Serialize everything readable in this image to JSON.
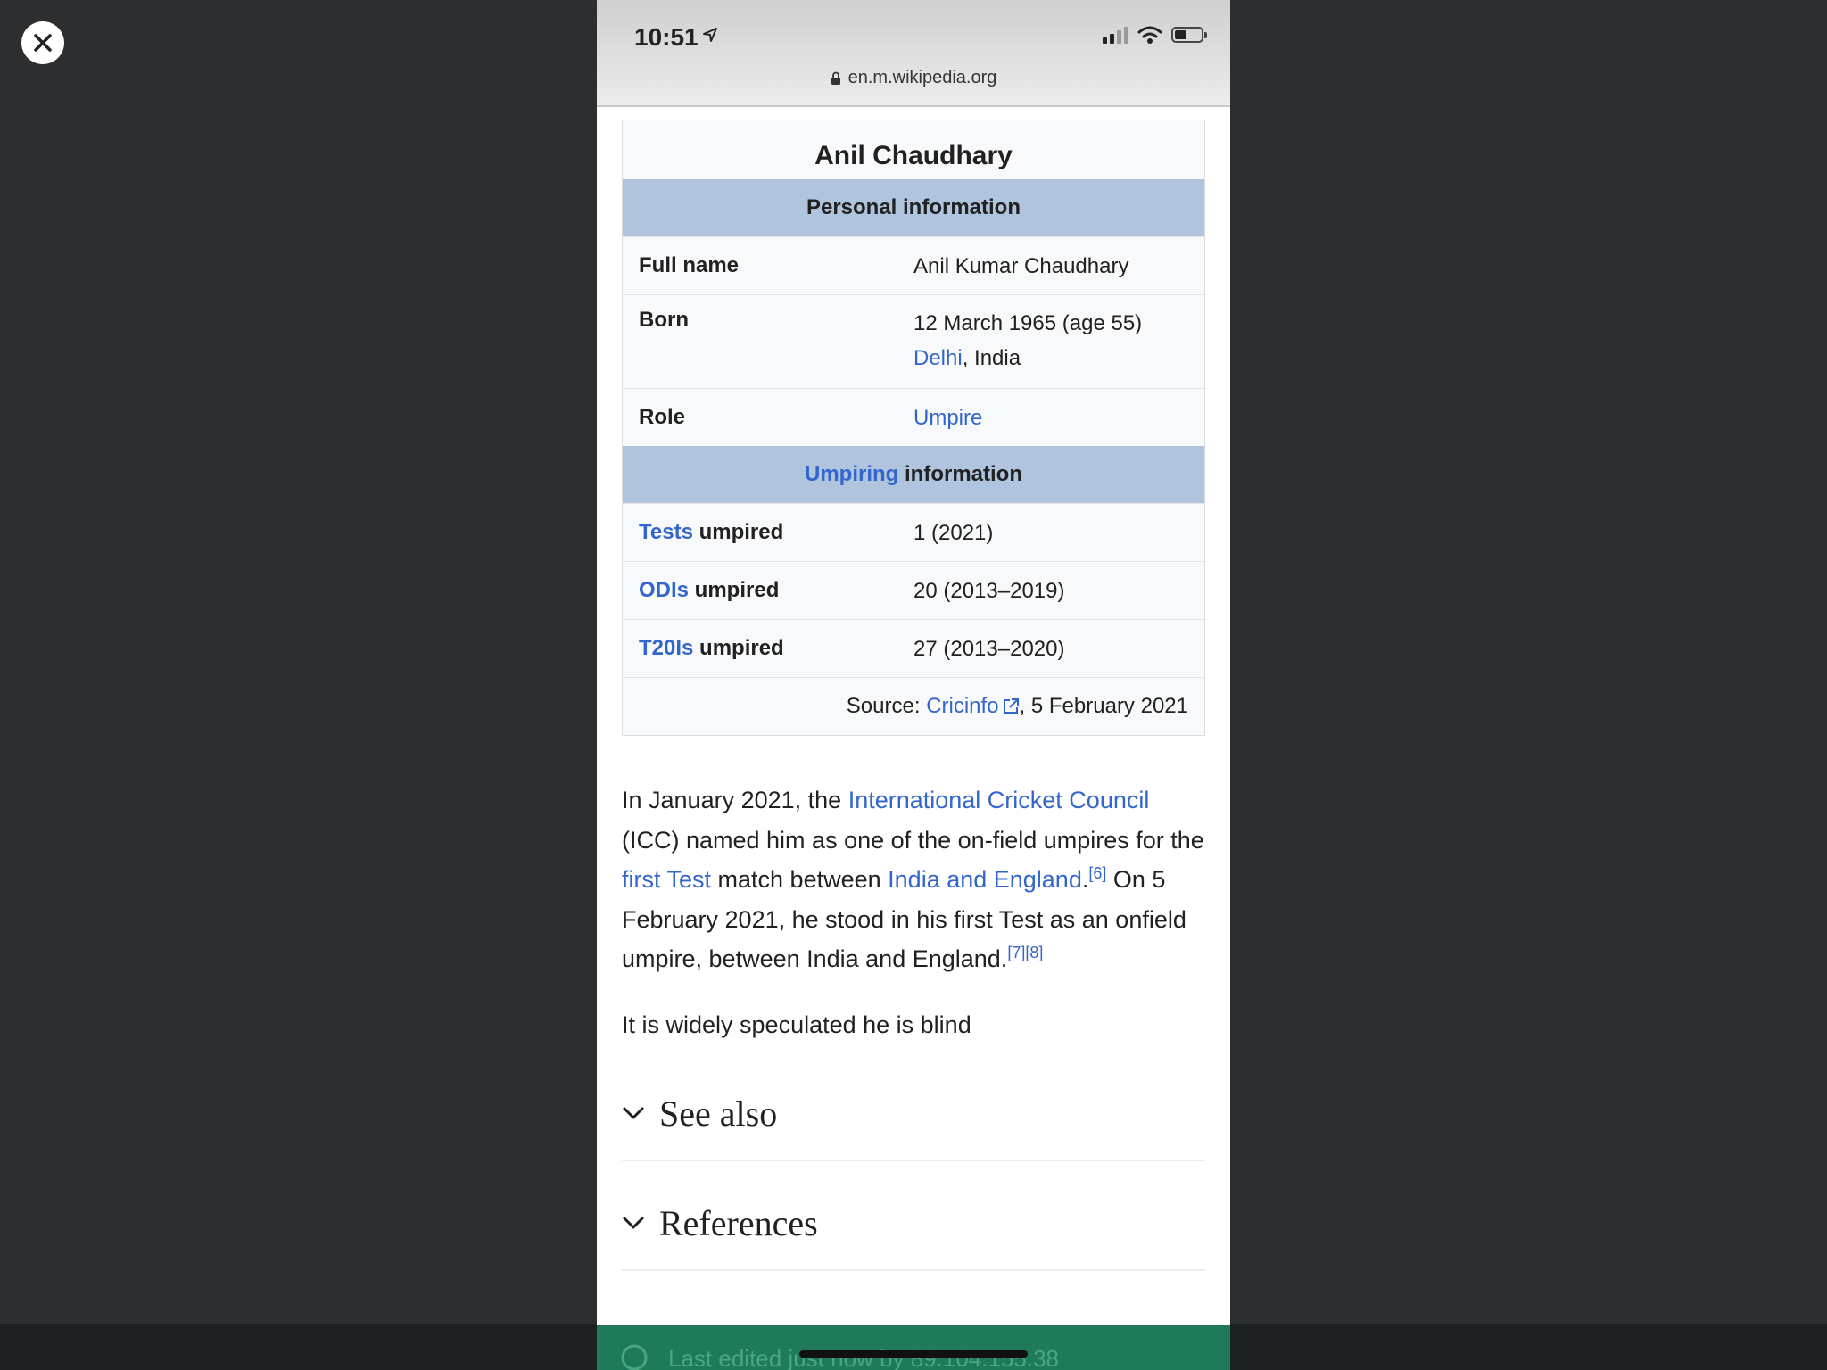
{
  "status_bar": {
    "time": "10:51",
    "url": "en.m.wikipedia.org"
  },
  "infobox": {
    "title": "Anil Chaudhary",
    "personal_header": "Personal information",
    "full_name_label": "Full name",
    "full_name_value": "Anil Kumar Chaudhary",
    "born_label": "Born",
    "born_line1": "12 March 1965 (age 55)",
    "born_city_link": "Delhi",
    "born_country": ", India",
    "role_label": "Role",
    "role_value": "Umpire",
    "umpiring_header_link": "Umpiring",
    "umpiring_header_rest": " information",
    "tests_link": "Tests",
    "odis_link": "ODIs",
    "t20is_link": "T20Is",
    "umpired_suffix": " umpired",
    "tests_value": "1 (2021)",
    "odis_value": "20 (2013–2019)",
    "t20is_value": "27 (2013–2020)",
    "source_prefix": "Source: ",
    "source_link": "Cricinfo",
    "source_date": ", 5 February 2021"
  },
  "article": {
    "p1_a": "In January 2021, the ",
    "p1_link1": "International Cricket Council",
    "p1_b": " (ICC) named him as one of the on-field umpires for the ",
    "p1_link2": "first Test",
    "p1_c": " match between ",
    "p1_link3": "India and England",
    "p1_d": ".",
    "ref6": "[6]",
    "p1_e": " On 5 February 2021, he stood in his first Test as an onfield umpire, between India and England.",
    "ref7": "[7]",
    "ref8": "[8]",
    "p2": "It is widely speculated he is blind"
  },
  "sections": {
    "see_also": "See also",
    "references": "References"
  },
  "footer": {
    "text": "Last edited just now by 89.104.155.38"
  },
  "colors": {
    "link": "#3366cc",
    "infobox_header": "#b0c4de",
    "footer": "#1f7a5a"
  }
}
